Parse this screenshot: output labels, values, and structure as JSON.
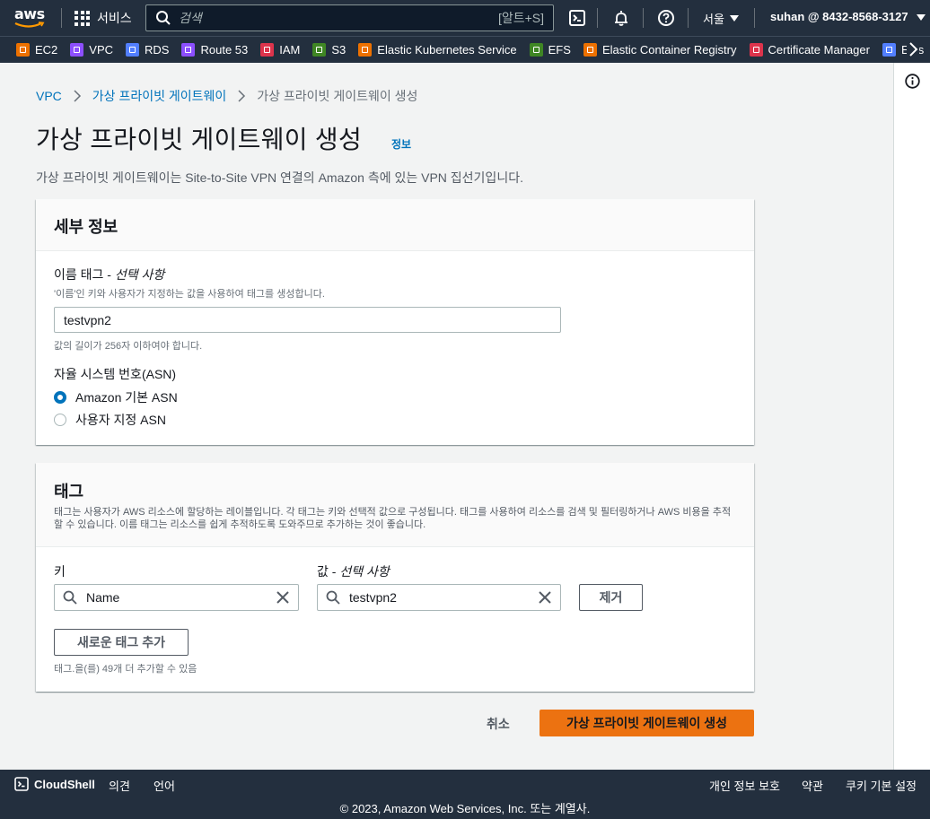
{
  "topnav": {
    "logo_text": "aws",
    "services_label": "서비스",
    "search_placeholder": "검색",
    "search_shortcut": "[알트+S]",
    "region": "서울",
    "account": "suhan @ 8432-8568-3127"
  },
  "favorites": [
    {
      "label": "EC2",
      "color": "#ed7100"
    },
    {
      "label": "VPC",
      "color": "#8c4fff"
    },
    {
      "label": "RDS",
      "color": "#527fff"
    },
    {
      "label": "Route 53",
      "color": "#8c4fff"
    },
    {
      "label": "IAM",
      "color": "#dd344c"
    },
    {
      "label": "S3",
      "color": "#3f8624"
    },
    {
      "label": "Elastic Kubernetes Service",
      "color": "#ed7100"
    },
    {
      "label": "EFS",
      "color": "#3f8624"
    },
    {
      "label": "Elastic Container Registry",
      "color": "#ed7100"
    },
    {
      "label": "Certificate Manager",
      "color": "#dd344c"
    },
    {
      "label": "Elas",
      "color": "#527fff"
    }
  ],
  "breadcrumb": {
    "items": [
      "VPC",
      "가상 프라이빗 게이트웨이"
    ],
    "current": "가상 프라이빗 게이트웨이 생성"
  },
  "page": {
    "title": "가상 프라이빗 게이트웨이 생성",
    "info": "정보",
    "description": "가상 프라이빗 게이트웨이는 Site-to-Site VPN 연결의 Amazon 측에 있는 VPN 집선기입니다."
  },
  "details": {
    "title": "세부 정보",
    "name_label": "이름 태그 - ",
    "name_label_optional": "선택 사항",
    "name_hint": "'이름'인 키와 사용자가 지정하는 값을 사용하여 태그를 생성합니다.",
    "name_value": "testvpn2",
    "name_constraint": "값의 길이가 256자 이하여야 합니다.",
    "asn_label": "자율 시스템 번호(ASN)",
    "asn_options": [
      "Amazon 기본 ASN",
      "사용자 지정 ASN"
    ],
    "asn_selected": 0
  },
  "tags": {
    "title": "태그",
    "description": "태그는 사용자가 AWS 리소스에 할당하는 레이블입니다. 각 태그는 키와 선택적 값으로 구성됩니다. 태그를 사용하여 리소스를 검색 및 필터링하거나 AWS 비용을 추적할 수 있습니다. 이름 태그는 리소스를 쉽게 추적하도록 도와주므로 추가하는 것이 좋습니다.",
    "key_label": "키",
    "value_label": "값 - ",
    "value_label_optional": "선택 사항",
    "key_value": "Name",
    "value_value": "testvpn2",
    "remove_label": "제거",
    "add_label": "새로운 태그 추가",
    "remaining": "태그.을(를) 49개 더 추가할 수 있음"
  },
  "actions": {
    "cancel": "취소",
    "create": "가상 프라이빗 게이트웨이 생성"
  },
  "footer": {
    "cloudshell": "CloudShell",
    "feedback": "의견",
    "language": "언어",
    "privacy": "개인 정보 보호",
    "terms": "약관",
    "cookies": "쿠키 기본 설정",
    "copyright": "© 2023, Amazon Web Services, Inc. 또는 계열사."
  },
  "colors": {
    "nav_bg": "#232f3e",
    "link": "#0073bb",
    "primary": "#ec7211"
  }
}
